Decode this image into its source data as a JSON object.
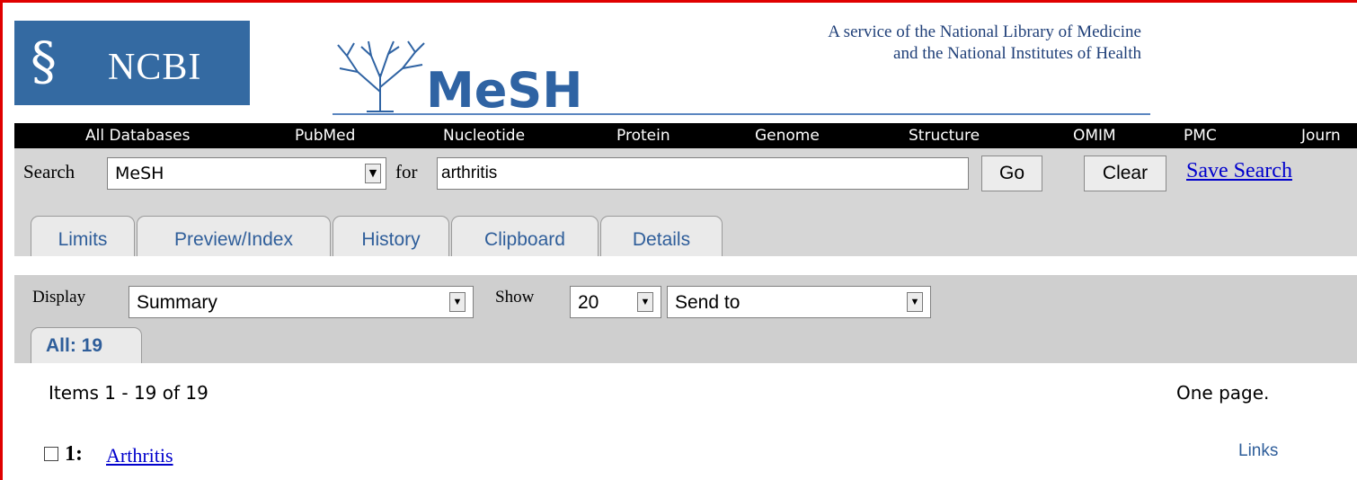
{
  "header": {
    "ncbi_logo_text": "NCBI",
    "mesh_logo_text": "MeSH",
    "service_line1": "A service of the National Library of Medicine",
    "service_line2": "and the National Institutes of Health"
  },
  "db_nav": {
    "items": [
      "All Databases",
      "PubMed",
      "Nucleotide",
      "Protein",
      "Genome",
      "Structure",
      "OMIM",
      "PMC",
      "Journ"
    ]
  },
  "search": {
    "search_label": "Search",
    "database_value": "MeSH",
    "for_label": "for",
    "query_value": "arthritis",
    "go_label": "Go",
    "clear_label": "Clear",
    "save_label": "Save Search"
  },
  "tabs": [
    "Limits",
    "Preview/Index",
    "History",
    "Clipboard",
    "Details"
  ],
  "display": {
    "display_label": "Display",
    "format_value": "Summary",
    "show_label": "Show",
    "count_value": "20",
    "send_value": "Send to",
    "all_tab_label": "All: 19"
  },
  "results": {
    "items_text": "Items 1 - 19 of 19",
    "pages_text": "One page.",
    "rows": [
      {
        "number": "1:",
        "title": "Arthritis",
        "links": "Links"
      }
    ]
  },
  "colors": {
    "ncbi_blue": "#346aa2",
    "mesh_blue": "#2f63a3",
    "link": "#0000cc",
    "tab_text": "#2f5e9a",
    "band_gray": "#d6d6d6"
  }
}
